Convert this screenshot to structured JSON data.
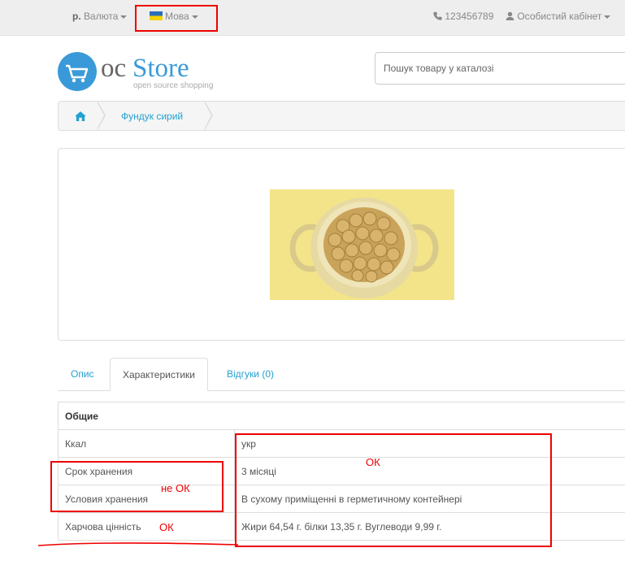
{
  "topbar": {
    "currency_symbol": "р.",
    "currency_label": "Валюта",
    "language_label": "Мова",
    "phone": "123456789",
    "account_label": "Особистий кабінет"
  },
  "logo": {
    "name_oc": "oc",
    "name_store": "Store",
    "tagline": "open source shopping"
  },
  "search": {
    "placeholder": "Пошук товару у каталозі"
  },
  "breadcrumb": {
    "current": "Фундук сирий"
  },
  "tabs": [
    {
      "label": "Опис"
    },
    {
      "label": "Характеристики"
    },
    {
      "label": "Відгуки (0)"
    }
  ],
  "spec_table": {
    "group": "Общие",
    "rows": [
      {
        "name": "Ккал",
        "value": "укр"
      },
      {
        "name": "Срок хранения",
        "value": "3 місяці"
      },
      {
        "name": "Условия хранения",
        "value": "В сухому приміщенні в герметичному контейнері"
      },
      {
        "name": "Харчова цінність",
        "value": "Жири 64,54 г. білки 13,35 г. Вуглеводи 9,99 г."
      }
    ]
  },
  "annotations": {
    "ok_1": "ОК",
    "not_ok": "не ОК",
    "ok_2": "ОК"
  },
  "colors": {
    "accent": "#23a1d1",
    "annotation_red": "#e00000"
  }
}
